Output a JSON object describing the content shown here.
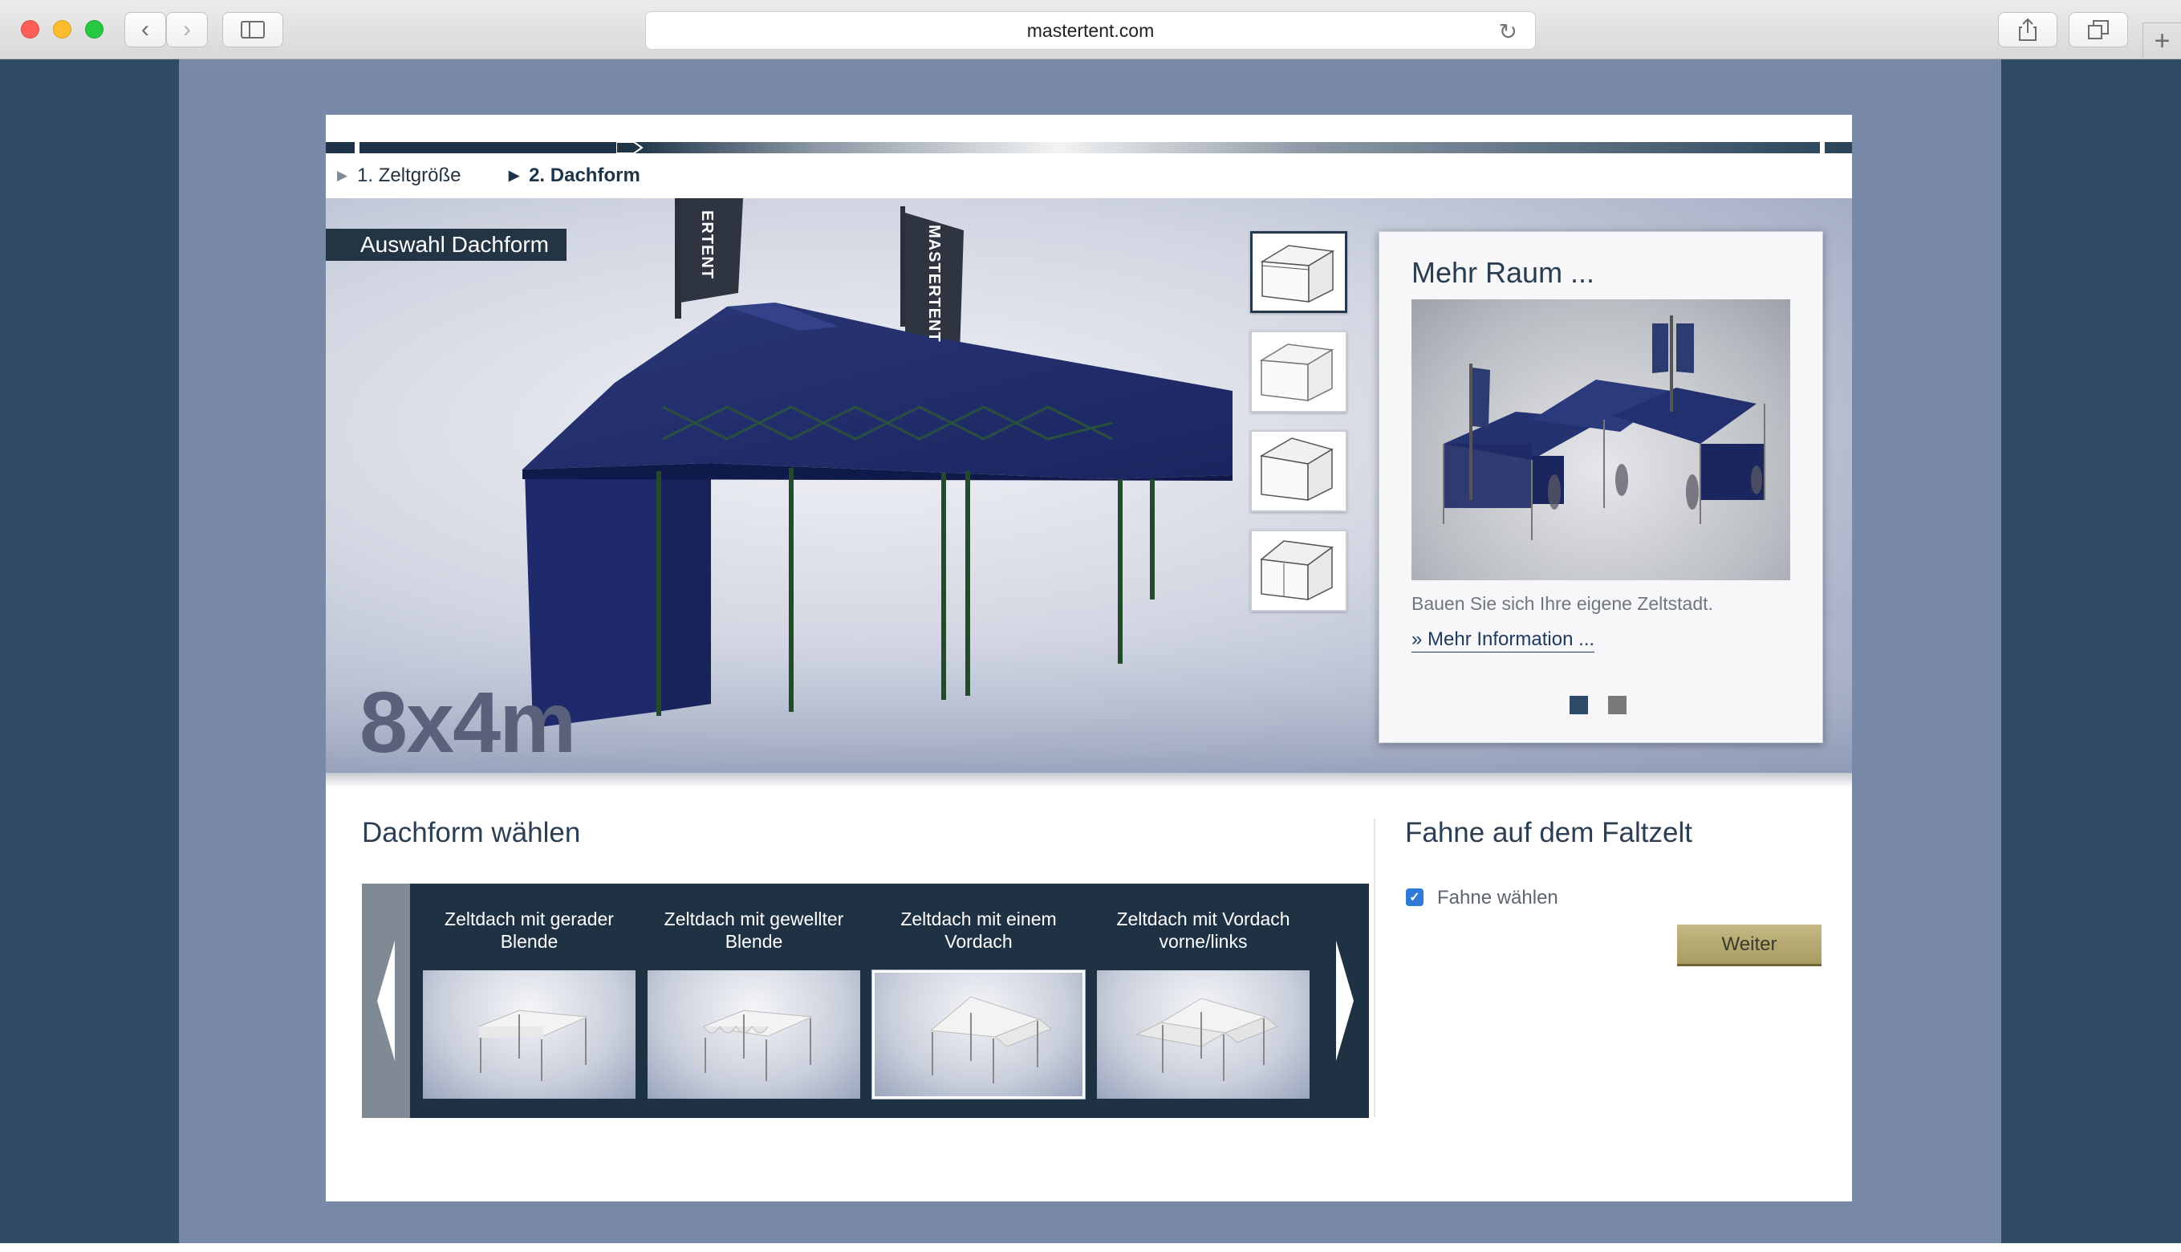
{
  "browser": {
    "url": "mastertent.com",
    "back_glyph": "‹",
    "forward_glyph": "›",
    "reload_glyph": "↻",
    "new_tab_glyph": "+",
    "traffic_light_colors": [
      "#fc5f57",
      "#fdbc2e",
      "#28c840"
    ]
  },
  "steps": [
    {
      "label": "1. Zeltgröße",
      "active": false
    },
    {
      "label": "2. Dachform",
      "active": true
    }
  ],
  "hero": {
    "tag": "Auswahl Dachform",
    "size": "8x4m",
    "flag_text": "MASTERTENT",
    "flag_text_partial": "ERTENT",
    "roof_thumbnails": [
      {
        "name": "roof-thumb-flat",
        "selected": true
      },
      {
        "name": "roof-thumb-wavy",
        "selected": false
      },
      {
        "name": "roof-thumb-canopy",
        "selected": false
      },
      {
        "name": "roof-thumb-canopy-sides",
        "selected": false
      }
    ]
  },
  "info": {
    "title": "Mehr Raum ...",
    "text": "Bauen Sie sich Ihre eigene Zeltstadt.",
    "link": "» Mehr Information ...",
    "pager": [
      {
        "active": true
      },
      {
        "active": false
      }
    ]
  },
  "roof_select": {
    "title": "Dachform wählen",
    "prev_glyph": "◀",
    "next_glyph": "▶",
    "options": [
      {
        "label": "Zeltdach mit gerader Blende",
        "selected": false
      },
      {
        "label": "Zeltdach mit gewellter Blende",
        "selected": false
      },
      {
        "label": "Zeltdach mit einem Vordach",
        "selected": true
      },
      {
        "label": "Zeltdach mit Vordach vorne/links",
        "selected": false
      }
    ]
  },
  "flag": {
    "title": "Fahne auf dem Faltzelt",
    "checkbox_label": "Fahne wählen",
    "checked": true,
    "check_glyph": "✓",
    "button": "Weiter"
  },
  "colors": {
    "page_bg": "#2f4a62",
    "center_bg": "#7889a8",
    "dark": "#1f3243",
    "button": "#b5a874",
    "link": "#1f3a60"
  }
}
